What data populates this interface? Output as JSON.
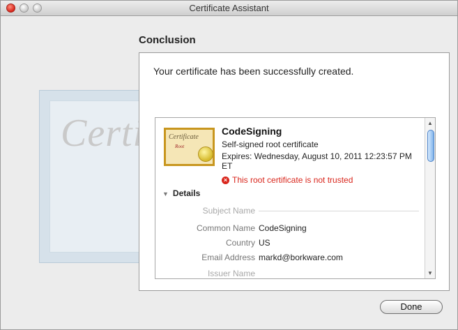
{
  "window": {
    "title": "Certificate Assistant"
  },
  "background": {
    "certificate_word": "Certif"
  },
  "heading": "Conclusion",
  "panel": {
    "message": "Your certificate has been successfully created.",
    "certificate": {
      "icon_word": "Certificate",
      "icon_sub": "Root",
      "name": "CodeSigning",
      "type": "Self-signed root certificate",
      "expires": "Expires: Wednesday, August 10, 2011 12:23:57 PM ET",
      "warning": "This root certificate is not trusted",
      "details_label": "Details",
      "subject_section": "Subject Name",
      "fields": [
        {
          "label": "Common Name",
          "value": "CodeSigning"
        },
        {
          "label": "Country",
          "value": "US"
        },
        {
          "label": "Email Address",
          "value": "markd@borkware.com"
        }
      ],
      "issuer_section": "Issuer Name"
    }
  },
  "buttons": {
    "done": "Done"
  },
  "icons": {
    "close": "close-icon",
    "minimize": "minimize-icon",
    "zoom": "zoom-icon",
    "warning": "error-icon",
    "disclosure": "disclosure-triangle-icon",
    "scroll_up": "scroll-up-icon",
    "scroll_down": "scroll-down-icon"
  },
  "colors": {
    "warning": "#d9261c",
    "accent": "#4d83c8"
  }
}
